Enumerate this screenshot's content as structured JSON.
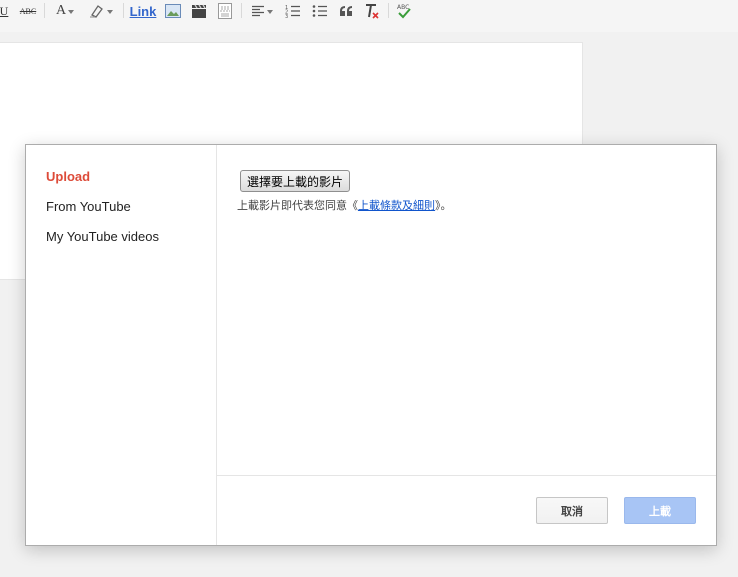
{
  "toolbar": {
    "underline": "U",
    "spellcheck_abc": "ABC",
    "font_color": "A",
    "link": "Link",
    "spellcheck_check_label": "ABC"
  },
  "dialog": {
    "nav": {
      "upload": "Upload",
      "from_youtube": "From YouTube",
      "my_videos": "My YouTube videos"
    },
    "choose_button": "選擇要上載的影片",
    "terms_prefix": "上載影片即代表您同意《",
    "terms_link": "上載條款及細則",
    "terms_suffix": "》。",
    "cancel": "取消",
    "upload_button": "上載"
  },
  "colors": {
    "active_nav": "#dd4b39",
    "link": "#3366cc",
    "upload_disabled": "#a8c5f5"
  }
}
